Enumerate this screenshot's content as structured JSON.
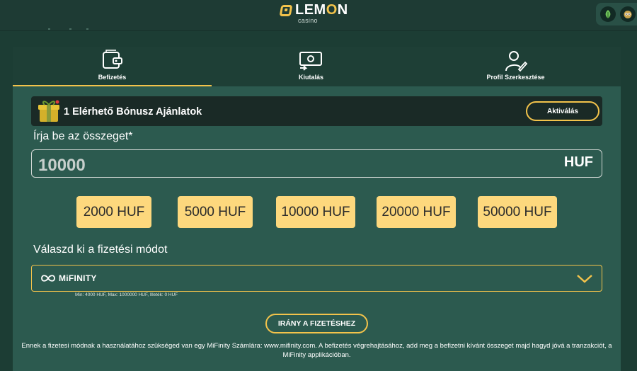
{
  "header": {
    "logo_text": "LEMON",
    "logo_sub": "casino",
    "top_icons": [
      "leaf-icon",
      "owl-icon"
    ]
  },
  "tabs": [
    {
      "label": "Befizetés",
      "icon": "wallet-icon",
      "active": true
    },
    {
      "label": "Kiutalás",
      "icon": "cash-icon",
      "active": false
    },
    {
      "label": "Profil Szerkesztése",
      "icon": "profile-edit-icon",
      "active": false
    }
  ],
  "bonus": {
    "text": "1 Elérhető Bónusz Ajánlatok",
    "button": "Aktiválás",
    "icon": "gift-box-icon"
  },
  "amount": {
    "label": "Írja be az összeget*",
    "value": "10000",
    "currency": "HUF"
  },
  "quick_amounts": [
    "2000 HUF",
    "5000 HUF",
    "10000 HUF",
    "20000 HUF",
    "50000 HUF"
  ],
  "payment": {
    "label": "Válaszd ki a fizetési módot",
    "selected": "MiFINITY",
    "limits": "Min: 4000 HUF, Max: 1000000 HUF, Illeték: 0 HUF"
  },
  "submit_button": "IRÁNY A FIZETÉSHEZ",
  "info_text": "Ennek a fizetesi módnak a használatához szükséged van egy MiFinity Számlára: www.mifinity.com. A befizetés végrehajtásához, add meg a befizetni kívánt összeget majd hagyd jóvá a tranzakciót, a MiFinity applikációban.",
  "colors": {
    "accent": "#f3c34b",
    "chip": "#fdd87d",
    "panel": "#2c5a4f",
    "background": "#1c3d34"
  }
}
